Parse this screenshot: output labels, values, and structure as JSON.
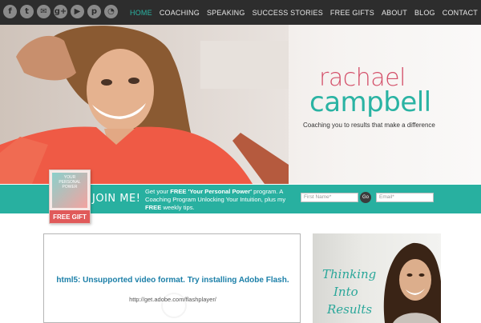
{
  "social": {
    "icons": [
      {
        "name": "facebook-icon",
        "glyph": "f"
      },
      {
        "name": "twitter-icon",
        "glyph": "t"
      },
      {
        "name": "email-icon",
        "glyph": "✉"
      },
      {
        "name": "google-plus-icon",
        "glyph": "g+"
      },
      {
        "name": "youtube-icon",
        "glyph": "▶"
      },
      {
        "name": "pinterest-icon",
        "glyph": "p"
      },
      {
        "name": "rss-icon",
        "glyph": "◔"
      }
    ]
  },
  "nav": {
    "home": "HOME",
    "coaching": "COACHING",
    "speaking": "SPEAKING",
    "success": "SUCCESS STORIES",
    "gifts": "FREE GIFTS",
    "about": "ABOUT",
    "blog": "BLOG",
    "contact": "CONTACT"
  },
  "hero": {
    "logo_first": "rachael",
    "logo_last": "campbell",
    "tagline": "Coaching you to results that make a difference"
  },
  "optin": {
    "book_band": "FREE GIFT",
    "book_title": "YOUR PERSONAL POWER",
    "join_title": "JOIN ME!",
    "text_1": "Get your ",
    "text_free": "FREE",
    "text_title": " 'Your Personal Power'",
    "text_2": " program. A Coaching Program Unlocking Your Intuition, plus my ",
    "text_free2": "FREE",
    "text_3": " weekly tips.",
    "first_name_placeholder": "First Name*",
    "go_label": "Go",
    "email_placeholder": "Email*"
  },
  "video": {
    "message": "html5: Unsupported video format. Try installing Adobe Flash.",
    "url": "http://get.adobe.com/flashplayer/"
  },
  "promo": {
    "line1": "Thinking",
    "line2": "Into",
    "line3": "Results"
  },
  "colors": {
    "accent": "#28b0a0",
    "brand_pink": "#d4506a",
    "topbar": "#2d2d2d"
  }
}
